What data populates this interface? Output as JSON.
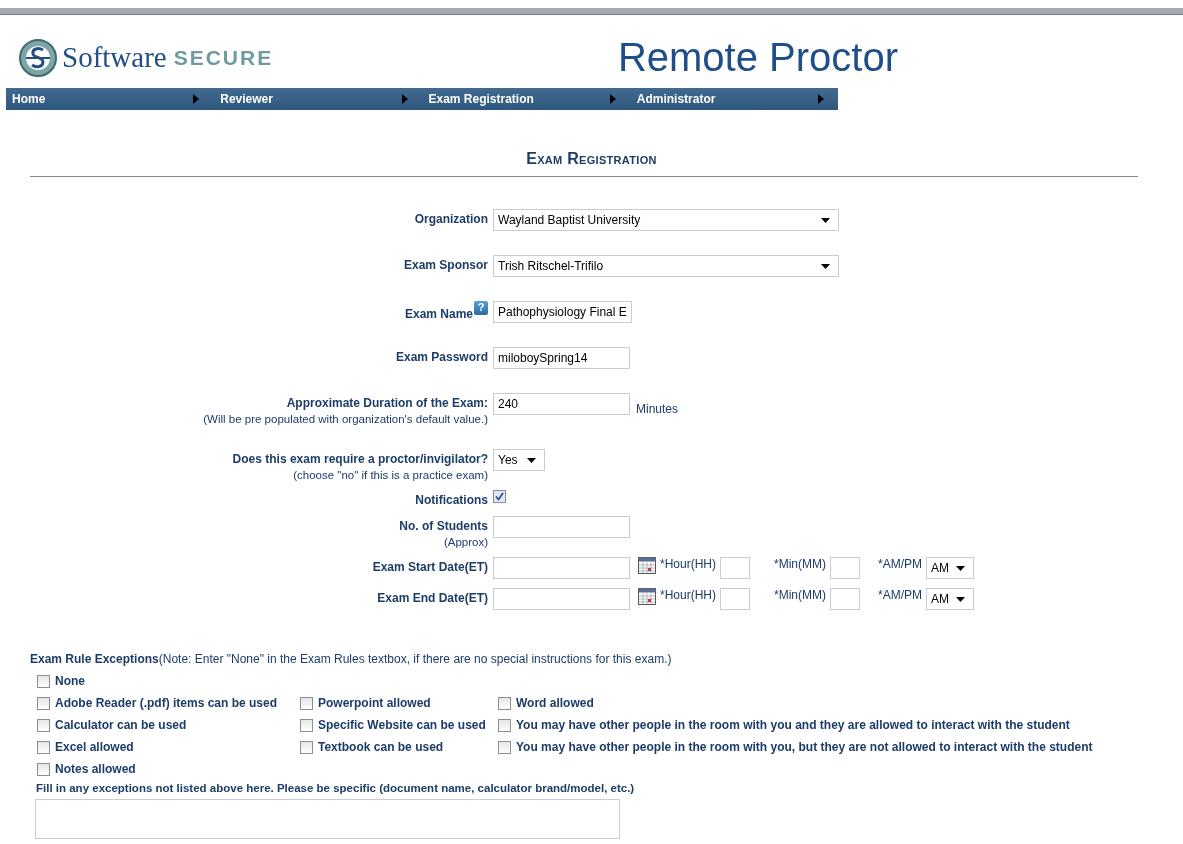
{
  "header": {
    "logo_brand": "Software",
    "logo_suffix": "SECURE",
    "product_title": "Remote Proctor"
  },
  "nav": [
    {
      "label": "Home"
    },
    {
      "label": "Reviewer"
    },
    {
      "label": "Exam Registration"
    },
    {
      "label": "Administrator"
    }
  ],
  "page_title": "Exam Registration",
  "fields": [
    {
      "kind": "select",
      "label": "Organization",
      "value": "Wayland Baptist University"
    },
    {
      "kind": "select",
      "label": "Exam Sponsor",
      "value": "Trish Ritschel-Trifilo"
    },
    {
      "kind": "text",
      "label": "Exam Name",
      "help": "?",
      "value": "Pathophysiology Final E"
    },
    {
      "kind": "text",
      "label": "Exam Password",
      "value": "miloboySpring14"
    },
    {
      "kind": "text",
      "label": "Approximate Duration of the Exam:",
      "note": "(Will be pre populated with organization's default value.)",
      "value": "240",
      "unit": "Minutes"
    },
    {
      "kind": "smallselect",
      "label": "Does this exam require a proctor/invigilator?",
      "note": "(choose \"no\" if this is a practice exam)",
      "value": "Yes"
    },
    {
      "kind": "checkbox",
      "label": "Notifications",
      "checked": true
    },
    {
      "kind": "text",
      "label": "No. of Students",
      "note": "(Approx)"
    },
    {
      "kind": "datetime",
      "label": "Exam Start Date(ET)",
      "hour_label": "*Hour(HH)",
      "min_label": "*Min(MM)",
      "ampm_label": "*AM/PM",
      "ampm": "AM"
    },
    {
      "kind": "datetime",
      "label": "Exam End Date(ET)",
      "hour_label": "*Hour(HH)",
      "min_label": "*Min(MM)",
      "ampm_label": "*AM/PM",
      "ampm": "AM"
    }
  ],
  "exceptions": {
    "title": "Exam Rule Exceptions",
    "note": "(Note: Enter \"None\" in the Exam Rules textbox, if there are no special instructions for this exam.)",
    "rows": [
      [
        {
          "label": "None",
          "checked": false
        }
      ],
      [
        {
          "label": "Adobe Reader (.pdf) items can be used",
          "checked": false
        },
        {
          "label": "Powerpoint allowed",
          "checked": false
        },
        {
          "label": "Word allowed",
          "checked": false
        }
      ],
      [
        {
          "label": "Calculator can be used",
          "checked": false
        },
        {
          "label": "Specific Website can be used",
          "checked": false
        },
        {
          "label": "You may have other people in the room with you and they are allowed to interact with the student",
          "checked": false
        }
      ],
      [
        {
          "label": "Excel allowed",
          "checked": false
        },
        {
          "label": "Textbook can be used",
          "checked": false
        },
        {
          "label": "You may have other people in the room with you, but they are not allowed to interact with the student",
          "checked": false
        }
      ],
      [
        {
          "label": "Notes allowed",
          "checked": false
        }
      ]
    ],
    "other_label": "Fill in any exceptions not listed above here. Please be specific (document name, calculator brand/model, etc.)"
  }
}
